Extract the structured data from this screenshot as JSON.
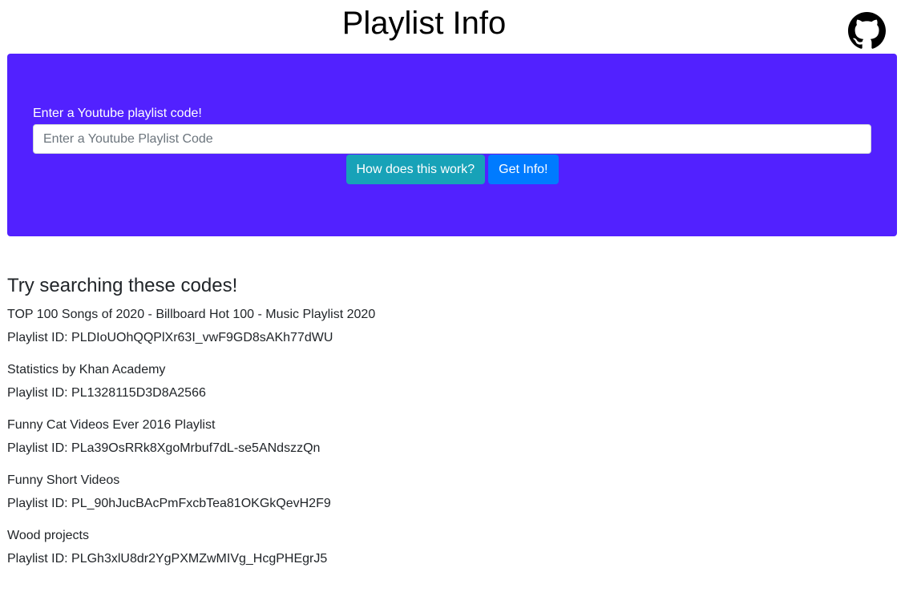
{
  "header": {
    "title": "Playlist Info",
    "github_icon": "github-icon"
  },
  "hero": {
    "background_color": "#5221ff",
    "label": "Enter a Youtube playlist code!",
    "input_placeholder": "Enter a Youtube Playlist Code",
    "input_value": "",
    "how_button_label": "How does this work?",
    "get_info_button_label": "Get Info!"
  },
  "suggestions": {
    "heading": "Try searching these codes!",
    "id_prefix": "Playlist ID:",
    "items": [
      {
        "name": "TOP 100 Songs of 2020 - Billboard Hot 100 - Music Playlist 2020",
        "id": "PLDIoUOhQQPlXr63I_vwF9GD8sAKh77dWU"
      },
      {
        "name": "Statistics by Khan Academy",
        "id": "PL1328115D3D8A2566"
      },
      {
        "name": "Funny Cat Videos Ever 2016 Playlist",
        "id": "PLa39OsRRk8XgoMrbuf7dL-se5ANdszzQn"
      },
      {
        "name": "Funny Short Videos",
        "id": "PL_90hJucBAcPmFxcbTea81OKGkQevH2F9"
      },
      {
        "name": "Wood projects",
        "id": "PLGh3xlU8dr2YgPXMZwMIVg_HcgPHEgrJ5"
      }
    ]
  }
}
